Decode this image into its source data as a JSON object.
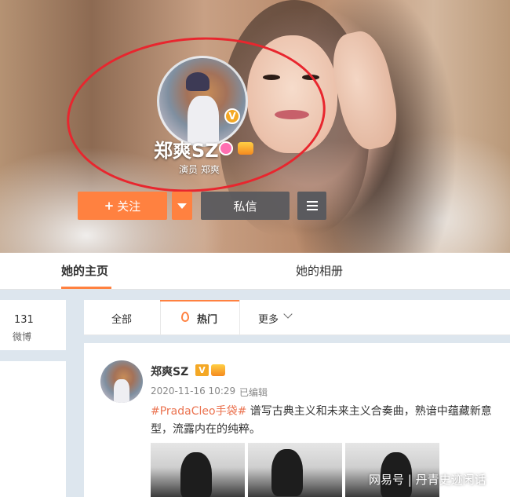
{
  "profile": {
    "name": "郑爽SZ",
    "subtitle": "演员 郑爽",
    "verified_badge": "V",
    "actions": {
      "follow_plus": "+",
      "follow_label": "关注",
      "message_label": "私信"
    }
  },
  "tabs": {
    "home": "她的主页",
    "album": "她的相册"
  },
  "stats": {
    "count": "131",
    "label": "微博"
  },
  "feed_tabs": {
    "all": "全部",
    "hot": "热门",
    "more": "更多"
  },
  "post": {
    "author": "郑爽SZ",
    "verified": "V",
    "time": "2020-11-16 10:29",
    "edited": "已编辑",
    "hashtag": "#PradaCleo手袋#",
    "text": " 谱写古典主义和未来主义合奏曲，熟谙中蕴藏新意型，流露内在的纯粹。"
  },
  "watermark": "网易号 | 丹青史迹闲话",
  "colors": {
    "accent": "#ff8140",
    "highlight_circle": "#e8262e",
    "hashtag": "#eb7350",
    "dark_button": "#5a5a5e"
  },
  "icons": [
    "verified-v-icon",
    "pink-badge-icon",
    "crown-badge-icon",
    "menu-icon",
    "dropdown-arrow-icon",
    "fire-icon",
    "chevron-down-icon"
  ]
}
